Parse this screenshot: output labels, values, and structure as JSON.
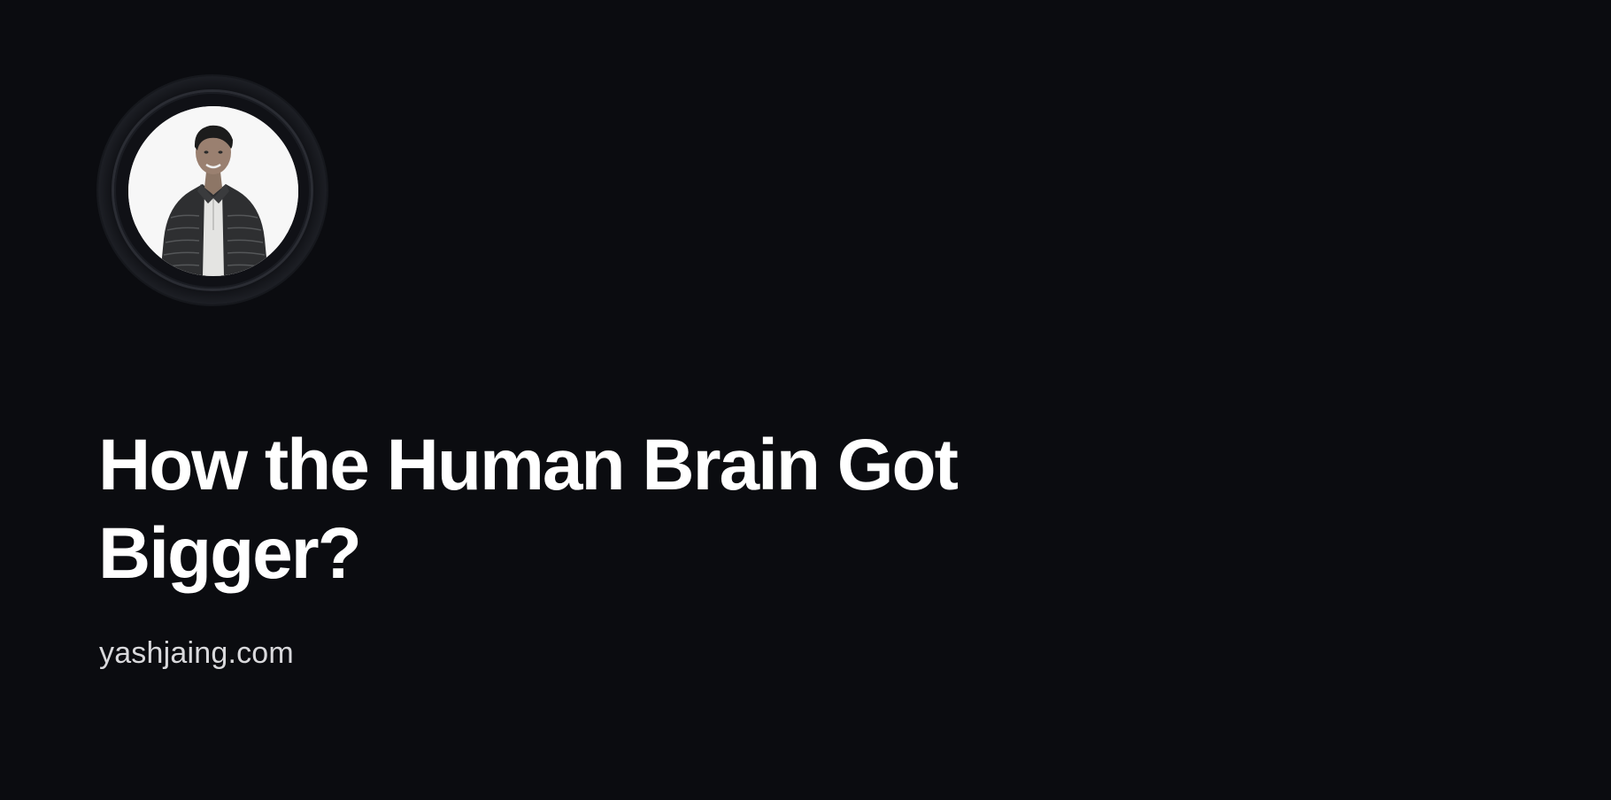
{
  "card": {
    "title": "How the Human Brain Got Bigger?",
    "site": "yashjaing.com"
  },
  "avatar": {
    "icon": "person-photo-avatar"
  },
  "colors": {
    "background": "#0b0c10",
    "title": "#ffffff",
    "site": "#d9d9dc",
    "ring": "#2a2c33"
  }
}
